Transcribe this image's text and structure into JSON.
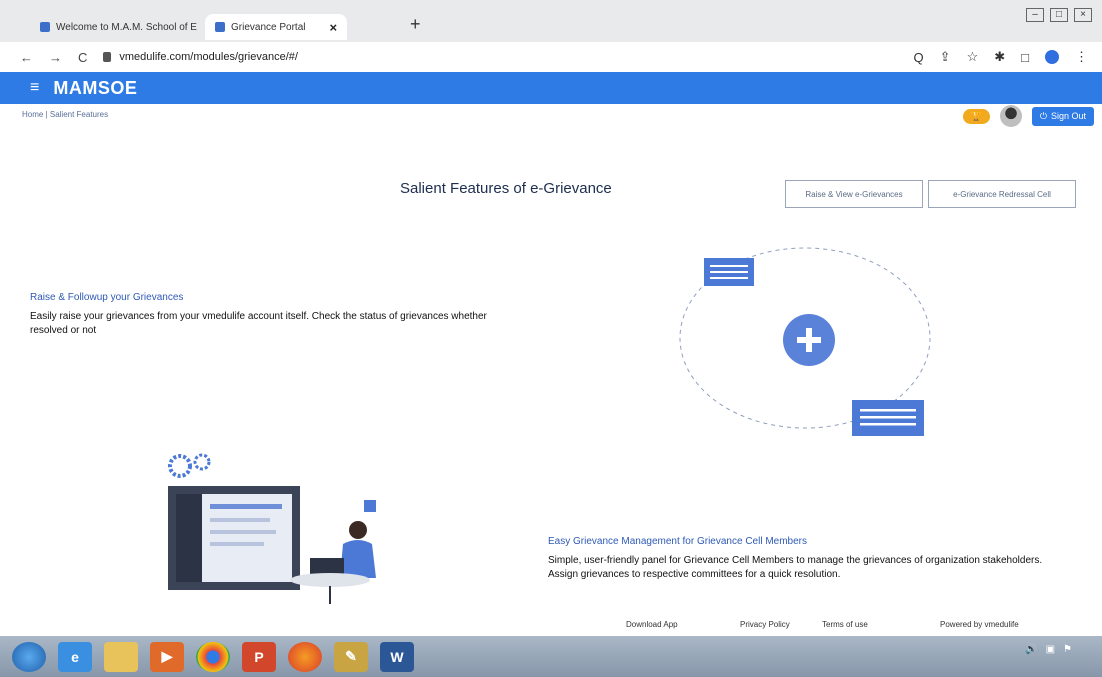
{
  "browser": {
    "tabs": [
      {
        "label": "Welcome to M.A.M. School of E",
        "close": "×"
      },
      {
        "label": "Grievance Portal",
        "close": "×"
      }
    ],
    "new_tab": "+",
    "url": "vmedulife.com/modules/grievance/#/",
    "nav": {
      "back": "←",
      "forward": "→",
      "reload": "C"
    },
    "toolbar_icons": {
      "search": "Q",
      "share": "⇪",
      "star": "☆",
      "extensions": "✱",
      "sidebar": "□",
      "menu": "⋮"
    }
  },
  "app": {
    "brand": "MAMSOE",
    "menu_icon": "≡",
    "breadcrumb": "Home | Salient Features",
    "signout": "Sign Out",
    "accent_color": "#2f7be6"
  },
  "main": {
    "title": "Salient Features of e-Grievance",
    "buttons": {
      "raise": "Raise & View e-Grievances",
      "cell": "e-Grievance Redressal Cell"
    },
    "features": [
      {
        "heading": "Raise & Followup your Grievances",
        "text": "Easily raise your grievances from your vmedulife account itself. Check the status of grievances whether resolved or not"
      },
      {
        "heading": "Easy Grievance Management for Grievance Cell Members",
        "text": "Simple, user-friendly panel for Grievance Cell Members to manage the grievances of organization stakeholders. Assign grievances to respective committees for a quick resolution."
      }
    ]
  },
  "footer": {
    "download": "Download App",
    "privacy": "Privacy Policy",
    "terms": "Terms of use",
    "powered": "Powered by vmedulife"
  },
  "taskbar": {
    "word_label": "W"
  }
}
